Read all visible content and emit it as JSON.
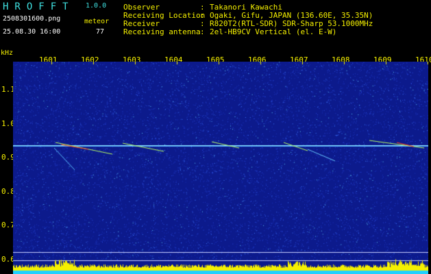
{
  "brand": {
    "name": "HROFFT",
    "version": "1.0.0"
  },
  "left_info": {
    "filename": "2508301600.png",
    "timestamp": "25.08.30 16:00",
    "meteor_label": "meteor",
    "meteor_count": "77"
  },
  "header": {
    "rows": [
      {
        "label": "Observer",
        "value": "Takanori Kawachi"
      },
      {
        "label": "Receiving Location",
        "value": "Ogaki, Gifu, JAPAN (136.60E, 35.35N)"
      },
      {
        "label": "Receiver",
        "value": "R820T2(RTL-SDR) SDR-Sharp 53.1000MHz"
      },
      {
        "label": "Receiving antenna",
        "value": "2el-HB9CV Vertical (el. E-W)"
      }
    ],
    "separator": ":"
  },
  "axis": {
    "y_unit": "kHz",
    "y_ticks": [
      "1.1",
      "1.0",
      "0.9",
      "0.8",
      "0.7",
      "0.6"
    ],
    "x_ticks": [
      "1601",
      "1602",
      "1603",
      "1604",
      "1605",
      "1606",
      "1607",
      "1608",
      "1609",
      "1610"
    ]
  },
  "colors": {
    "background": "#000000",
    "spectrum_bg": "#0c1a8c",
    "noise": "#2a4adf",
    "carrier": "#8fe6ff",
    "meteor": "#b8ff60",
    "echo_hot": "#ff4020",
    "yellow_text": "#f5f000",
    "cyan_text": "#3fe0e0",
    "amplitude": "#f5f000",
    "baseline": "#20d0ff"
  }
}
